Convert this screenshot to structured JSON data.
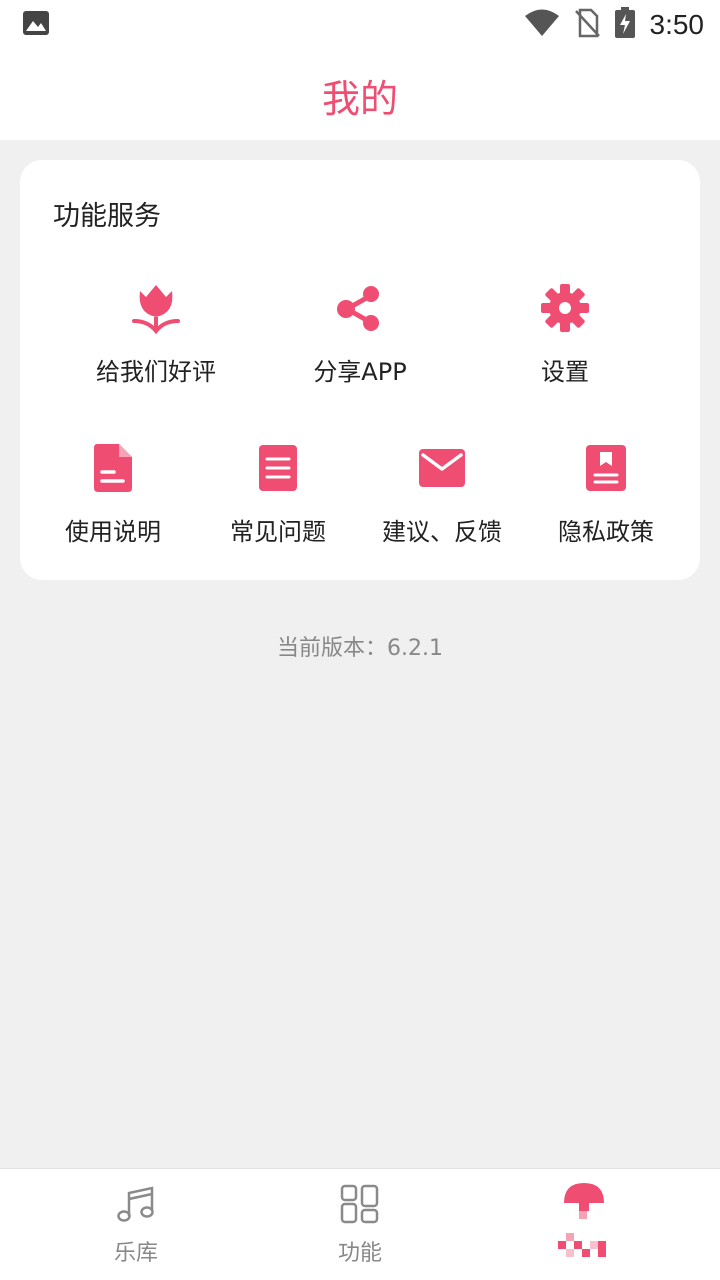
{
  "status_bar": {
    "time": "3:50",
    "icons": [
      "image-notification-icon",
      "wifi-icon",
      "no-sim-icon",
      "battery-charging-icon"
    ]
  },
  "header": {
    "title": "我的"
  },
  "services": {
    "title": "功能服务",
    "items": [
      {
        "label": "给我们好评",
        "icon": "tulip-icon"
      },
      {
        "label": "分享APP",
        "icon": "share-icon"
      },
      {
        "label": "设置",
        "icon": "gear-icon"
      },
      {
        "label": "使用说明",
        "icon": "document-icon"
      },
      {
        "label": "常见问题",
        "icon": "faq-list-icon"
      },
      {
        "label": "建议、反馈",
        "icon": "envelope-icon"
      },
      {
        "label": "隐私政策",
        "icon": "bookmark-icon"
      }
    ]
  },
  "version": {
    "text": "当前版本：6.2.1"
  },
  "bottom_nav": {
    "items": [
      {
        "label": "乐库",
        "icon": "music-note-icon",
        "active": false
      },
      {
        "label": "功能",
        "icon": "grid-icon",
        "active": false
      },
      {
        "label": "",
        "icon": "mushroom-pixel-icon",
        "active": true
      }
    ]
  },
  "colors": {
    "accent": "#ef4d72",
    "background": "#f0f0f0",
    "card": "#ffffff",
    "muted": "#888888"
  }
}
